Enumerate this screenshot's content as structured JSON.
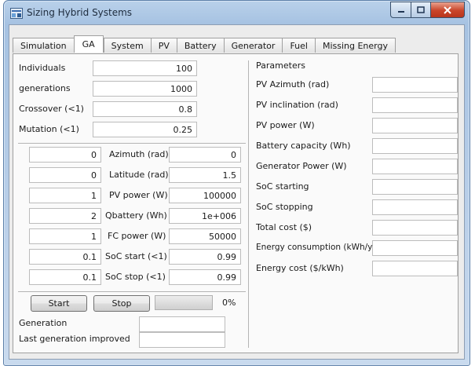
{
  "window": {
    "title": "Sizing Hybrid Systems"
  },
  "tabs": [
    "Simulation",
    "GA",
    "System",
    "PV",
    "Battery",
    "Generator",
    "Fuel",
    "Missing Energy"
  ],
  "active_tab": "GA",
  "ga_params": [
    {
      "label": "Individuals",
      "value": "100"
    },
    {
      "label": "generations",
      "value": "1000"
    },
    {
      "label": "Crossover (<1)",
      "value": "0.8"
    },
    {
      "label": "Mutation (<1)",
      "value": "0.25"
    }
  ],
  "ranges": [
    {
      "min": "0",
      "label": "Azimuth (rad)",
      "max": "0"
    },
    {
      "min": "0",
      "label": "Latitude (rad)",
      "max": "1.5"
    },
    {
      "min": "1",
      "label": "PV power (W)",
      "max": "100000"
    },
    {
      "min": "2",
      "label": "Qbattery (Wh)",
      "max": "1e+006"
    },
    {
      "min": "1",
      "label": "FC power (W)",
      "max": "50000"
    },
    {
      "min": "0.1",
      "label": "SoC start (<1)",
      "max": "0.99"
    },
    {
      "min": "0.1",
      "label": "SoC stop (<1)",
      "max": "0.99"
    }
  ],
  "controls": {
    "start_label": "Start",
    "stop_label": "Stop",
    "progress": 0,
    "progress_text": "0%"
  },
  "status": {
    "generation_label": "Generation",
    "generation_value": "",
    "last_improved_label": "Last generation improved",
    "last_improved_value": ""
  },
  "parameters": {
    "heading": "Parameters",
    "items": [
      {
        "label": "PV Azimuth (rad)",
        "value": ""
      },
      {
        "label": "PV inclination (rad)",
        "value": ""
      },
      {
        "label": "PV power (W)",
        "value": ""
      },
      {
        "label": "Battery capacity (Wh)",
        "value": ""
      },
      {
        "label": "Generator Power (W)",
        "value": ""
      },
      {
        "label": "SoC starting",
        "value": ""
      },
      {
        "label": "SoC stopping",
        "value": ""
      },
      {
        "label": "Total cost ($)",
        "value": ""
      },
      {
        "label": "Energy consumption (kWh/yr)",
        "value": ""
      },
      {
        "label": "Energy cost ($/kWh)",
        "value": ""
      }
    ]
  }
}
